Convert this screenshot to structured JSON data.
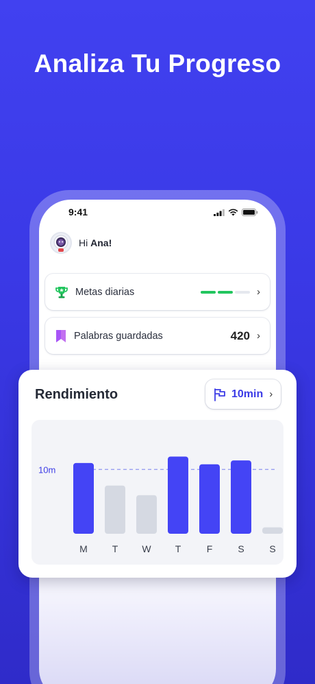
{
  "headline": "Analiza Tu Progreso",
  "status_bar": {
    "time": "9:41"
  },
  "greeting": {
    "prefix": "Hi ",
    "name": "Ana!"
  },
  "cards": {
    "daily_goals": {
      "label": "Metas diarias",
      "progress_segments_done": 2,
      "progress_segments_total": 3,
      "icon": "trophy-icon"
    },
    "saved_words": {
      "label": "Palabras guardadas",
      "count": "420",
      "icon": "bookmark-icon"
    }
  },
  "performance": {
    "title": "Rendimiento",
    "goal_button": {
      "label": "10min",
      "icon": "flag-icon"
    }
  },
  "colors": {
    "accent": "#4444f5",
    "goal_green": "#22c55e",
    "inactive_bar": "#d5d9e2"
  },
  "chart_data": {
    "type": "bar",
    "categories": [
      "M",
      "T",
      "W",
      "T",
      "F",
      "S",
      "S"
    ],
    "values": [
      11,
      7.5,
      6,
      12,
      10.8,
      11.4,
      1
    ],
    "goal_line": 10,
    "goal_label": "10m",
    "highlight": [
      true,
      false,
      false,
      true,
      true,
      true,
      false
    ],
    "ylim": [
      0,
      12.8
    ],
    "grid": false
  }
}
